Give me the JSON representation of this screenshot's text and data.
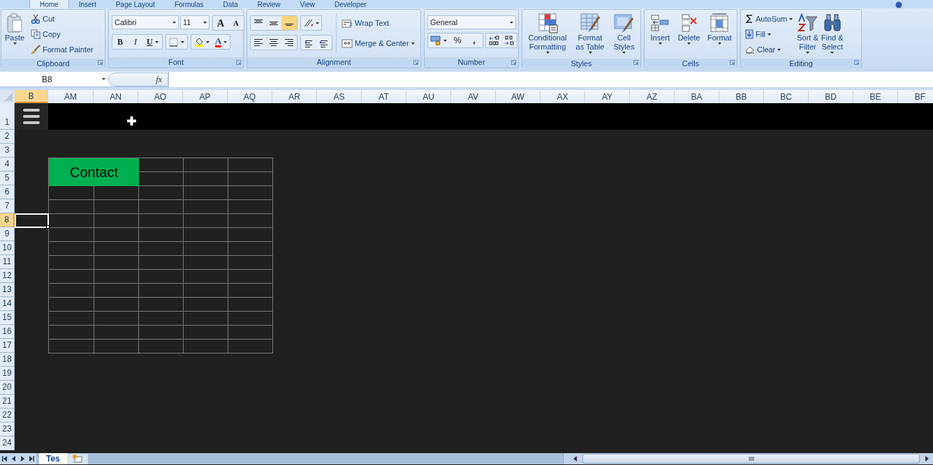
{
  "ribbon_tabs": [
    {
      "label": "Home",
      "selected": true
    },
    {
      "label": "Insert",
      "selected": false
    },
    {
      "label": "Page Layout",
      "selected": false
    },
    {
      "label": "Formulas",
      "selected": false
    },
    {
      "label": "Data",
      "selected": false
    },
    {
      "label": "Review",
      "selected": false
    },
    {
      "label": "View",
      "selected": false
    },
    {
      "label": "Developer",
      "selected": false
    }
  ],
  "clipboard": {
    "label": "Clipboard",
    "paste": "Paste",
    "cut": "Cut",
    "copy": "Copy",
    "format_painter": "Format Painter"
  },
  "font": {
    "label": "Font",
    "font_name": "Calibri",
    "font_size": "11",
    "grow": "A",
    "shrink": "A",
    "bold": "B",
    "italic": "I",
    "underline": "U",
    "font_color": "A"
  },
  "alignment": {
    "label": "Alignment",
    "vertical": [
      {
        "selected": false
      },
      {
        "selected": false
      },
      {
        "selected": true
      }
    ],
    "horizontal": [
      {
        "selected": false
      },
      {
        "selected": false
      },
      {
        "selected": false
      }
    ],
    "wrap_text": "Wrap Text",
    "merge_center": "Merge & Center"
  },
  "number": {
    "label": "Number",
    "format": "General",
    "percent": "%",
    "comma": ","
  },
  "styles": {
    "label": "Styles",
    "buttons": [
      "Conditional\nFormatting",
      "Format\nas Table",
      "Cell\nStyles"
    ]
  },
  "cells": {
    "label": "Cells",
    "buttons": [
      "Insert",
      "Delete",
      "Format"
    ]
  },
  "editing": {
    "label": "Editing",
    "small": [
      "AutoSum",
      "Fill",
      "Clear"
    ],
    "large": [
      "Sort &\nFilter",
      "Find &\nSelect"
    ]
  },
  "formula_bar": {
    "name_box": "B8",
    "fx": "fx"
  },
  "columns": [
    {
      "label": "B",
      "selected": true
    },
    {
      "label": "AM",
      "selected": false
    },
    {
      "label": "AN",
      "selected": false
    },
    {
      "label": "AO",
      "selected": false
    },
    {
      "label": "AP",
      "selected": false
    },
    {
      "label": "AQ",
      "selected": false
    },
    {
      "label": "AR",
      "selected": false
    },
    {
      "label": "AS",
      "selected": false
    },
    {
      "label": "AT",
      "selected": false
    },
    {
      "label": "AU",
      "selected": false
    },
    {
      "label": "AV",
      "selected": false
    },
    {
      "label": "AW",
      "selected": false
    },
    {
      "label": "AX",
      "selected": false
    },
    {
      "label": "AY",
      "selected": false
    },
    {
      "label": "AZ",
      "selected": false
    },
    {
      "label": "BA",
      "selected": false
    },
    {
      "label": "BB",
      "selected": false
    },
    {
      "label": "BC",
      "selected": false
    },
    {
      "label": "BD",
      "selected": false
    },
    {
      "label": "BE",
      "selected": false
    },
    {
      "label": "BF",
      "selected": false
    }
  ],
  "rows": [
    {
      "label": "1",
      "selected": false
    },
    {
      "label": "2",
      "selected": false
    },
    {
      "label": "3",
      "selected": false
    },
    {
      "label": "4",
      "selected": false
    },
    {
      "label": "5",
      "selected": false
    },
    {
      "label": "6",
      "selected": false
    },
    {
      "label": "7",
      "selected": false
    },
    {
      "label": "8",
      "selected": true
    },
    {
      "label": "9",
      "selected": false
    },
    {
      "label": "10",
      "selected": false
    },
    {
      "label": "11",
      "selected": false
    },
    {
      "label": "12",
      "selected": false
    },
    {
      "label": "13",
      "selected": false
    },
    {
      "label": "14",
      "selected": false
    },
    {
      "label": "15",
      "selected": false
    },
    {
      "label": "16",
      "selected": false
    },
    {
      "label": "17",
      "selected": false
    },
    {
      "label": "18",
      "selected": false
    },
    {
      "label": "19",
      "selected": false
    },
    {
      "label": "20",
      "selected": false
    },
    {
      "label": "21",
      "selected": false
    },
    {
      "label": "22",
      "selected": false
    },
    {
      "label": "23",
      "selected": false
    },
    {
      "label": "24",
      "selected": false
    }
  ],
  "sheet": {
    "contact_button": "Contact"
  },
  "sheet_tabs": [
    {
      "label": "Tes",
      "selected": true
    }
  ]
}
